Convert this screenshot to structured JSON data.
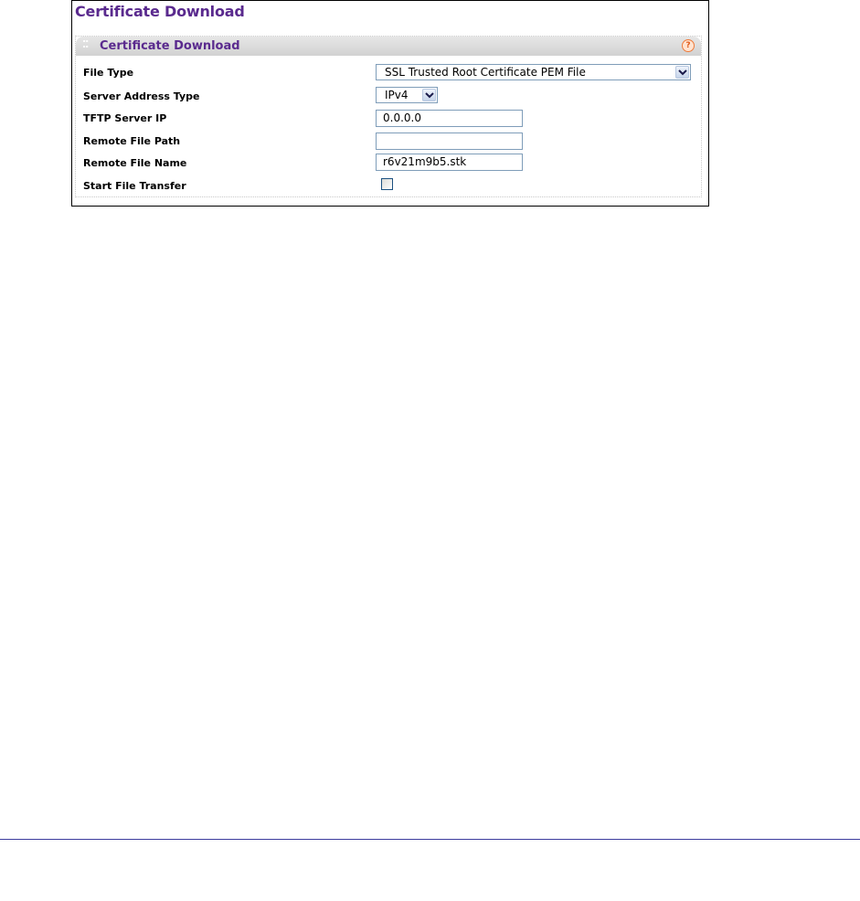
{
  "page": {
    "title": "Certificate Download"
  },
  "panel": {
    "title": "Certificate Download",
    "help_icon": "help-circle-icon",
    "grip_icon": "grip-dots-icon"
  },
  "form": {
    "file_type": {
      "label": "File Type",
      "selected": "SSL Trusted Root Certificate PEM File"
    },
    "server_address_type": {
      "label": "Server Address Type",
      "selected": "IPv4"
    },
    "tftp_server_ip": {
      "label": "TFTP Server IP",
      "value": "0.0.0.0"
    },
    "remote_file_path": {
      "label": "Remote File Path",
      "value": ""
    },
    "remote_file_name": {
      "label": "Remote File Name",
      "value": "r6v21m9b5.stk"
    },
    "start_file_transfer": {
      "label": "Start File Transfer",
      "checked": false
    }
  },
  "colors": {
    "title": "#5a2a8e",
    "help_accent": "#e05a1a",
    "input_border": "#7f9db9",
    "rule": "#3d3d9e"
  }
}
